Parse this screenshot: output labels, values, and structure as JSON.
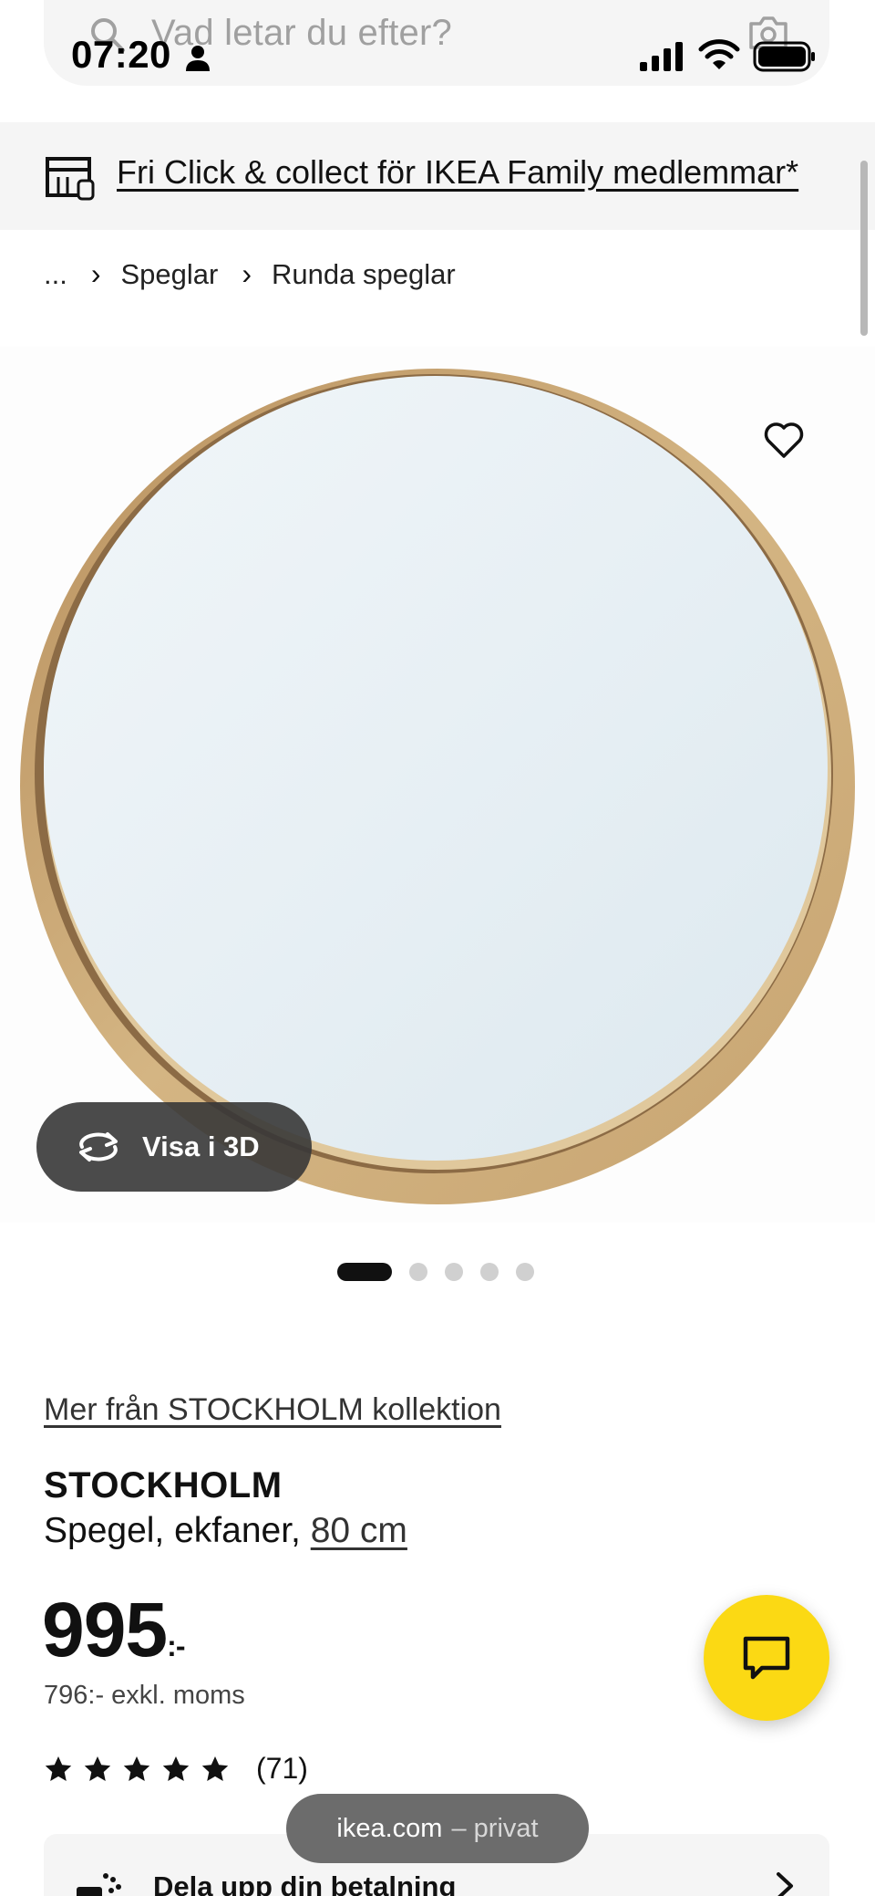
{
  "status_bar": {
    "time": "07:20"
  },
  "search": {
    "placeholder": "Vad letar du efter?"
  },
  "promo": {
    "text": "Fri Click & collect för IKEA Family medlemmar*"
  },
  "breadcrumb": {
    "ellipsis": "...",
    "items": [
      "Speglar",
      "Runda speglar"
    ]
  },
  "gallery": {
    "view_3d_label": "Visa i 3D",
    "image_count": 5,
    "active_index": 0
  },
  "product": {
    "collection_link": "Mer från STOCKHOLM kollektion",
    "name": "STOCKHOLM",
    "description": "Spegel, ekfaner, ",
    "size": "80 cm",
    "price": "995",
    "price_suffix": ":-",
    "price_ex_vat": "796:- exkl. moms",
    "rating_stars": 5,
    "review_count": "(71)"
  },
  "payment": {
    "label": "Dela upp din betalning"
  },
  "browser": {
    "domain": "ikea.com",
    "mode": "– privat"
  },
  "colors": {
    "chat_fab": "#fbd914",
    "text": "#111111",
    "panel_bg": "#f5f5f5",
    "mirror_frame": "#c9a878"
  },
  "icons": [
    "search-icon",
    "camera-icon",
    "person-icon",
    "signal-icon",
    "wifi-icon",
    "battery-icon",
    "store-icon",
    "heart-icon",
    "rotate-3d-icon",
    "star-icon",
    "chat-icon",
    "payment-icon",
    "chevron-right-icon"
  ]
}
